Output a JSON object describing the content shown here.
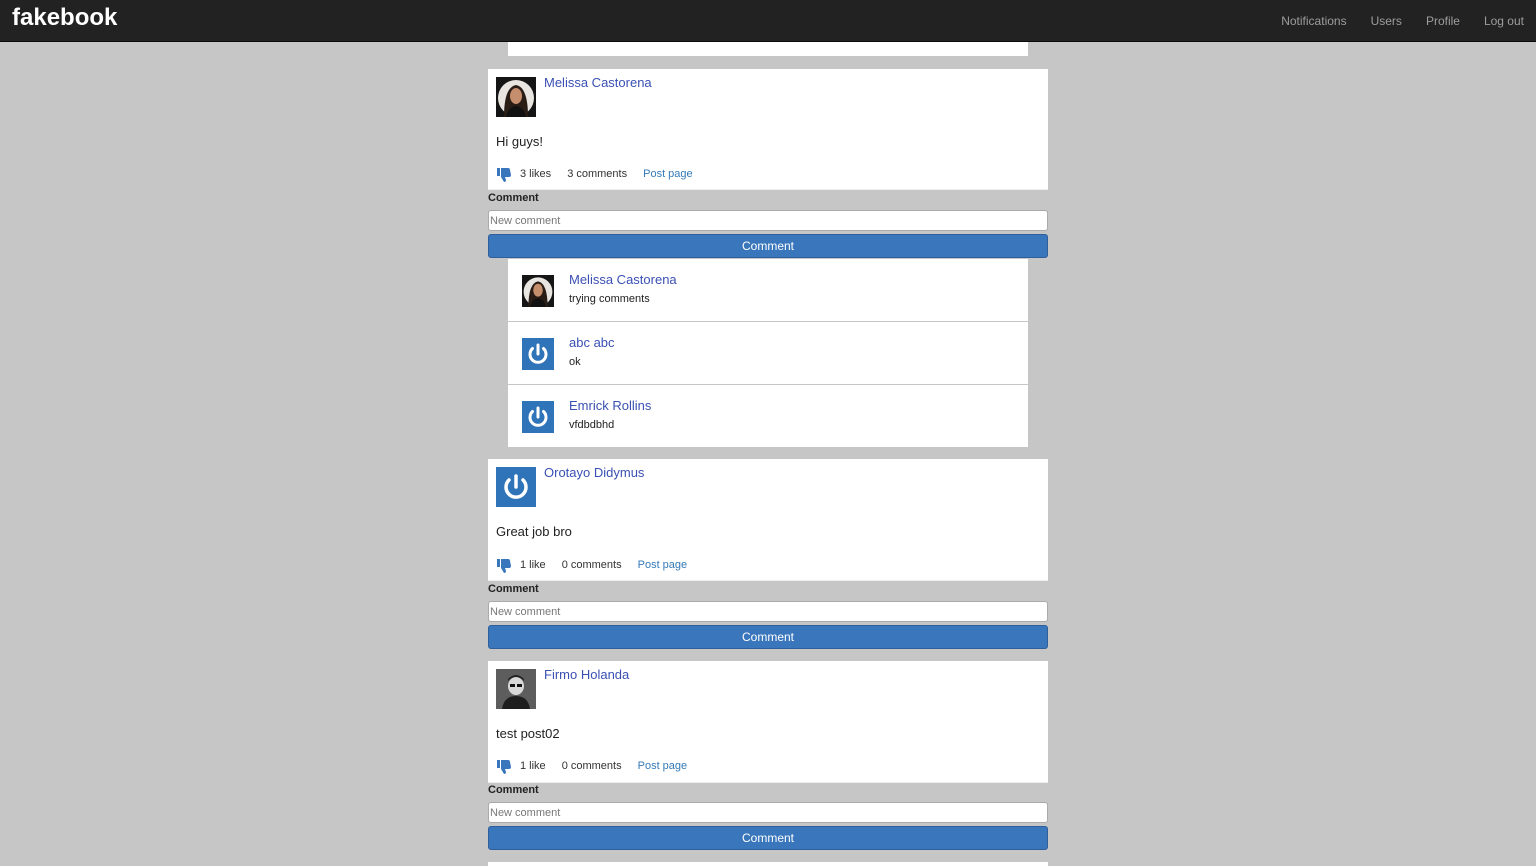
{
  "app": {
    "brand": "fakebook"
  },
  "nav": {
    "items": [
      {
        "label": "Notifications"
      },
      {
        "label": "Users"
      },
      {
        "label": "Profile"
      },
      {
        "label": "Log out"
      }
    ]
  },
  "colors": {
    "navbar": "#222222",
    "background": "#c6c6c6",
    "link": "#3a50b3",
    "button": "#3a76bc"
  },
  "posts": [
    {
      "author": "Melissa Castorena",
      "avatar_icon": "woman-portrait-avatar",
      "body": "Hi guys!",
      "likes": "3 likes",
      "comments_count": "3 comments",
      "link": "Post page",
      "form": {
        "label": "Comment",
        "placeholder": "New comment",
        "button": "Comment"
      },
      "comments": [
        {
          "author": "Melissa Castorena",
          "text": "trying comments",
          "avatar_icon": "woman-portrait-avatar"
        },
        {
          "author": "abc abc",
          "text": "ok",
          "avatar_icon": "power-icon"
        },
        {
          "author": "Emrick Rollins",
          "text": "vfdbdbhd",
          "avatar_icon": "power-icon"
        }
      ]
    },
    {
      "author": "Orotayo Didymus",
      "avatar_icon": "power-icon",
      "body": "Great job bro",
      "likes": "1 like",
      "comments_count": "0 comments",
      "link": "Post page",
      "form": {
        "label": "Comment",
        "placeholder": "New comment",
        "button": "Comment"
      }
    },
    {
      "author": "Firmo Holanda",
      "avatar_icon": "man-portrait-avatar",
      "body": "test post02",
      "likes": "1 like",
      "comments_count": "0 comments",
      "link": "Post page",
      "form": {
        "label": "Comment",
        "placeholder": "New comment",
        "button": "Comment"
      }
    }
  ]
}
